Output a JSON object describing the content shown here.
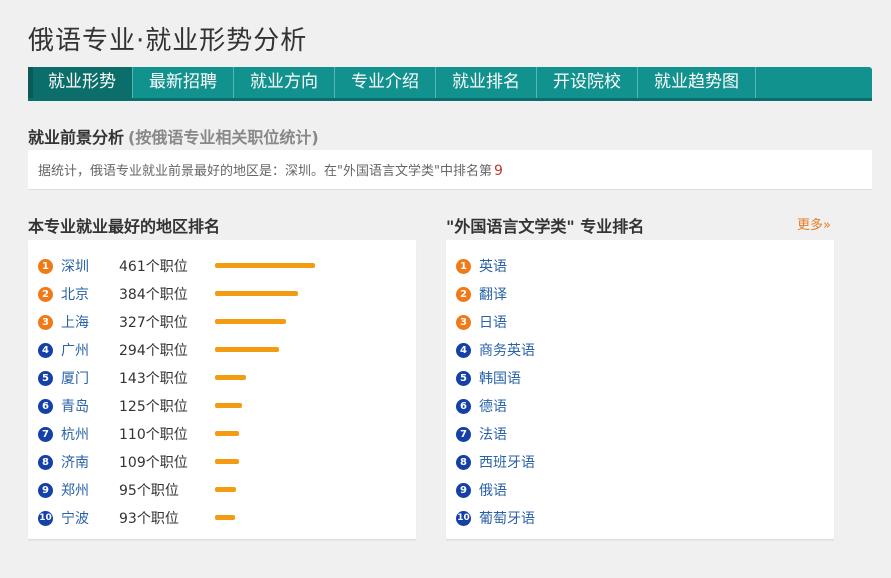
{
  "page": {
    "title": "俄语专业·就业形势分析"
  },
  "nav": [
    {
      "label": "就业形势",
      "active": true
    },
    {
      "label": "最新招聘"
    },
    {
      "label": "就业方向"
    },
    {
      "label": "专业介绍"
    },
    {
      "label": "就业排名"
    },
    {
      "label": "开设院校"
    },
    {
      "label": "就业趋势图"
    }
  ],
  "prospect": {
    "title": "就业前景分析",
    "subtitle": "(按俄语专业相关职位统计)",
    "summary_text": "据统计，俄语专业就业前景最好的地区是：深圳。在\"外国语言文学类\"中排名第",
    "rank": "9"
  },
  "regions": {
    "heading": "本专业就业最好的地区排名",
    "items": [
      {
        "rank": "1",
        "city": "深圳",
        "jobs": "461个职位",
        "count": 461
      },
      {
        "rank": "2",
        "city": "北京",
        "jobs": "384个职位",
        "count": 384
      },
      {
        "rank": "3",
        "city": "上海",
        "jobs": "327个职位",
        "count": 327
      },
      {
        "rank": "4",
        "city": "广州",
        "jobs": "294个职位",
        "count": 294
      },
      {
        "rank": "5",
        "city": "厦门",
        "jobs": "143个职位",
        "count": 143
      },
      {
        "rank": "6",
        "city": "青岛",
        "jobs": "125个职位",
        "count": 125
      },
      {
        "rank": "7",
        "city": "杭州",
        "jobs": "110个职位",
        "count": 110
      },
      {
        "rank": "8",
        "city": "济南",
        "jobs": "109个职位",
        "count": 109
      },
      {
        "rank": "9",
        "city": "郑州",
        "jobs": "95个职位",
        "count": 95
      },
      {
        "rank": "10",
        "city": "宁波",
        "jobs": "93个职位",
        "count": 93
      }
    ]
  },
  "majors": {
    "heading": "\"外国语言文学类\" 专业排名",
    "more_label": "更多»",
    "items": [
      {
        "rank": "1",
        "name": "英语"
      },
      {
        "rank": "2",
        "name": "翻译"
      },
      {
        "rank": "3",
        "name": "日语"
      },
      {
        "rank": "4",
        "name": "商务英语"
      },
      {
        "rank": "5",
        "name": "韩国语"
      },
      {
        "rank": "6",
        "name": "德语"
      },
      {
        "rank": "7",
        "name": "法语"
      },
      {
        "rank": "8",
        "name": "西班牙语"
      },
      {
        "rank": "9",
        "name": "俄语"
      },
      {
        "rank": "10",
        "name": "葡萄牙语"
      }
    ]
  },
  "colors": {
    "nav": "#12928f",
    "badge_top": "#f07a18",
    "badge_rest": "#1540a8",
    "bar": "#f39c12",
    "link": "#2a62a8"
  }
}
